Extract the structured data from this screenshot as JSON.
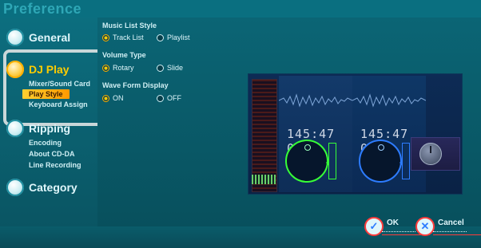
{
  "window": {
    "title": "Preference"
  },
  "sidebar": {
    "groups": [
      {
        "label": "General",
        "icon": "disc-icon",
        "active": false
      },
      {
        "label": "DJ Play",
        "icon": "disc-icon",
        "active": true,
        "items": [
          {
            "label": "Mixer/Sound Card",
            "active": false
          },
          {
            "label": "Play Style",
            "active": true
          },
          {
            "label": "Keyboard Assign",
            "active": false
          }
        ]
      },
      {
        "label": "Ripping",
        "icon": "disc-icon",
        "active": false,
        "items": [
          {
            "label": "Encoding",
            "active": false
          },
          {
            "label": "About CD-DA",
            "active": false
          },
          {
            "label": "Line Recording",
            "active": false
          }
        ]
      },
      {
        "label": "Category",
        "icon": "disc-icon",
        "active": false
      }
    ]
  },
  "settings": {
    "music_list_style": {
      "title": "Music List Style",
      "options": [
        {
          "label": "Track List",
          "selected": true
        },
        {
          "label": "Playlist",
          "selected": false
        }
      ]
    },
    "volume_type": {
      "title": "Volume Type",
      "options": [
        {
          "label": "Rotary",
          "selected": true
        },
        {
          "label": "Slide",
          "selected": false
        }
      ]
    },
    "wave_form_display": {
      "title": "Wave Form Display",
      "options": [
        {
          "label": "ON",
          "selected": true
        },
        {
          "label": "OFF",
          "selected": false
        }
      ]
    }
  },
  "preview": {
    "deck_left_time": "145:47 00",
    "deck_right_time": "145:47 00",
    "colors": {
      "deck_left": "#37ff37",
      "deck_right": "#2d7cff",
      "accent": "#ffcc00"
    }
  },
  "footer": {
    "ok_label": "OK",
    "cancel_label": "Cancel"
  }
}
